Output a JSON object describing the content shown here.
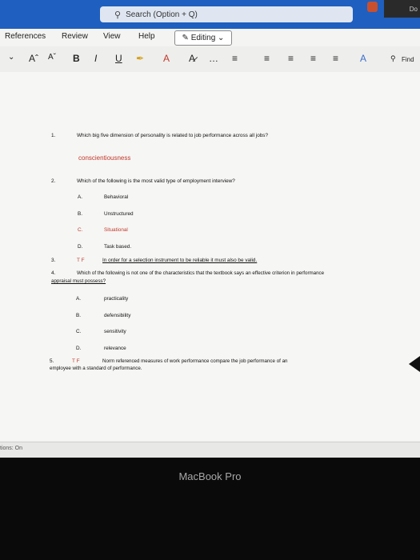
{
  "titlebar": {
    "search_placeholder": "Search (Option + Q)",
    "right_label": "Do"
  },
  "tabs": {
    "references": "References",
    "review": "Review",
    "view": "View",
    "help": "Help",
    "editing": "Editing"
  },
  "ribbon": {
    "font_grow": "Aˆ",
    "font_shrink": "Aˇ",
    "bold": "B",
    "italic": "I",
    "underline": "U",
    "more": "…",
    "find": "Find"
  },
  "doc": {
    "q1": {
      "num": "1.",
      "text": "Which big five dimension of personality is related to job performance across all jobs?",
      "answer": "conscientiousness"
    },
    "q2": {
      "num": "2.",
      "text": "Which of the following is the most valid type of employment interview?",
      "options": [
        {
          "letter": "A.",
          "text": "Behavioral"
        },
        {
          "letter": "B.",
          "text": "Unstructured"
        },
        {
          "letter": "C.",
          "text": "Situational"
        },
        {
          "letter": "D.",
          "text": "Task based."
        }
      ]
    },
    "q3": {
      "num": "3.",
      "tf": "T F",
      "text": "In order for a selection instrument to be reliable it must also be valid."
    },
    "q4": {
      "num": "4.",
      "text_line1": "Which of the following is not one of the characteristics that the textbook says an effective criterion in performance",
      "text_line2": "appraisal must possess?",
      "options": [
        {
          "letter": "A.",
          "text": "practicality"
        },
        {
          "letter": "B.",
          "text": "defensibility"
        },
        {
          "letter": "C.",
          "text": "sensitivity"
        },
        {
          "letter": "D.",
          "text": "relevance"
        }
      ]
    },
    "q5": {
      "num": "5.",
      "tf": "T F",
      "text_line1": "Norm referenced measures of work performance compare the job performance of an",
      "text_line2": "employee with a standard of performance."
    }
  },
  "status": {
    "left_text": "tions: On"
  },
  "bezel": {
    "label": "MacBook Pro"
  }
}
